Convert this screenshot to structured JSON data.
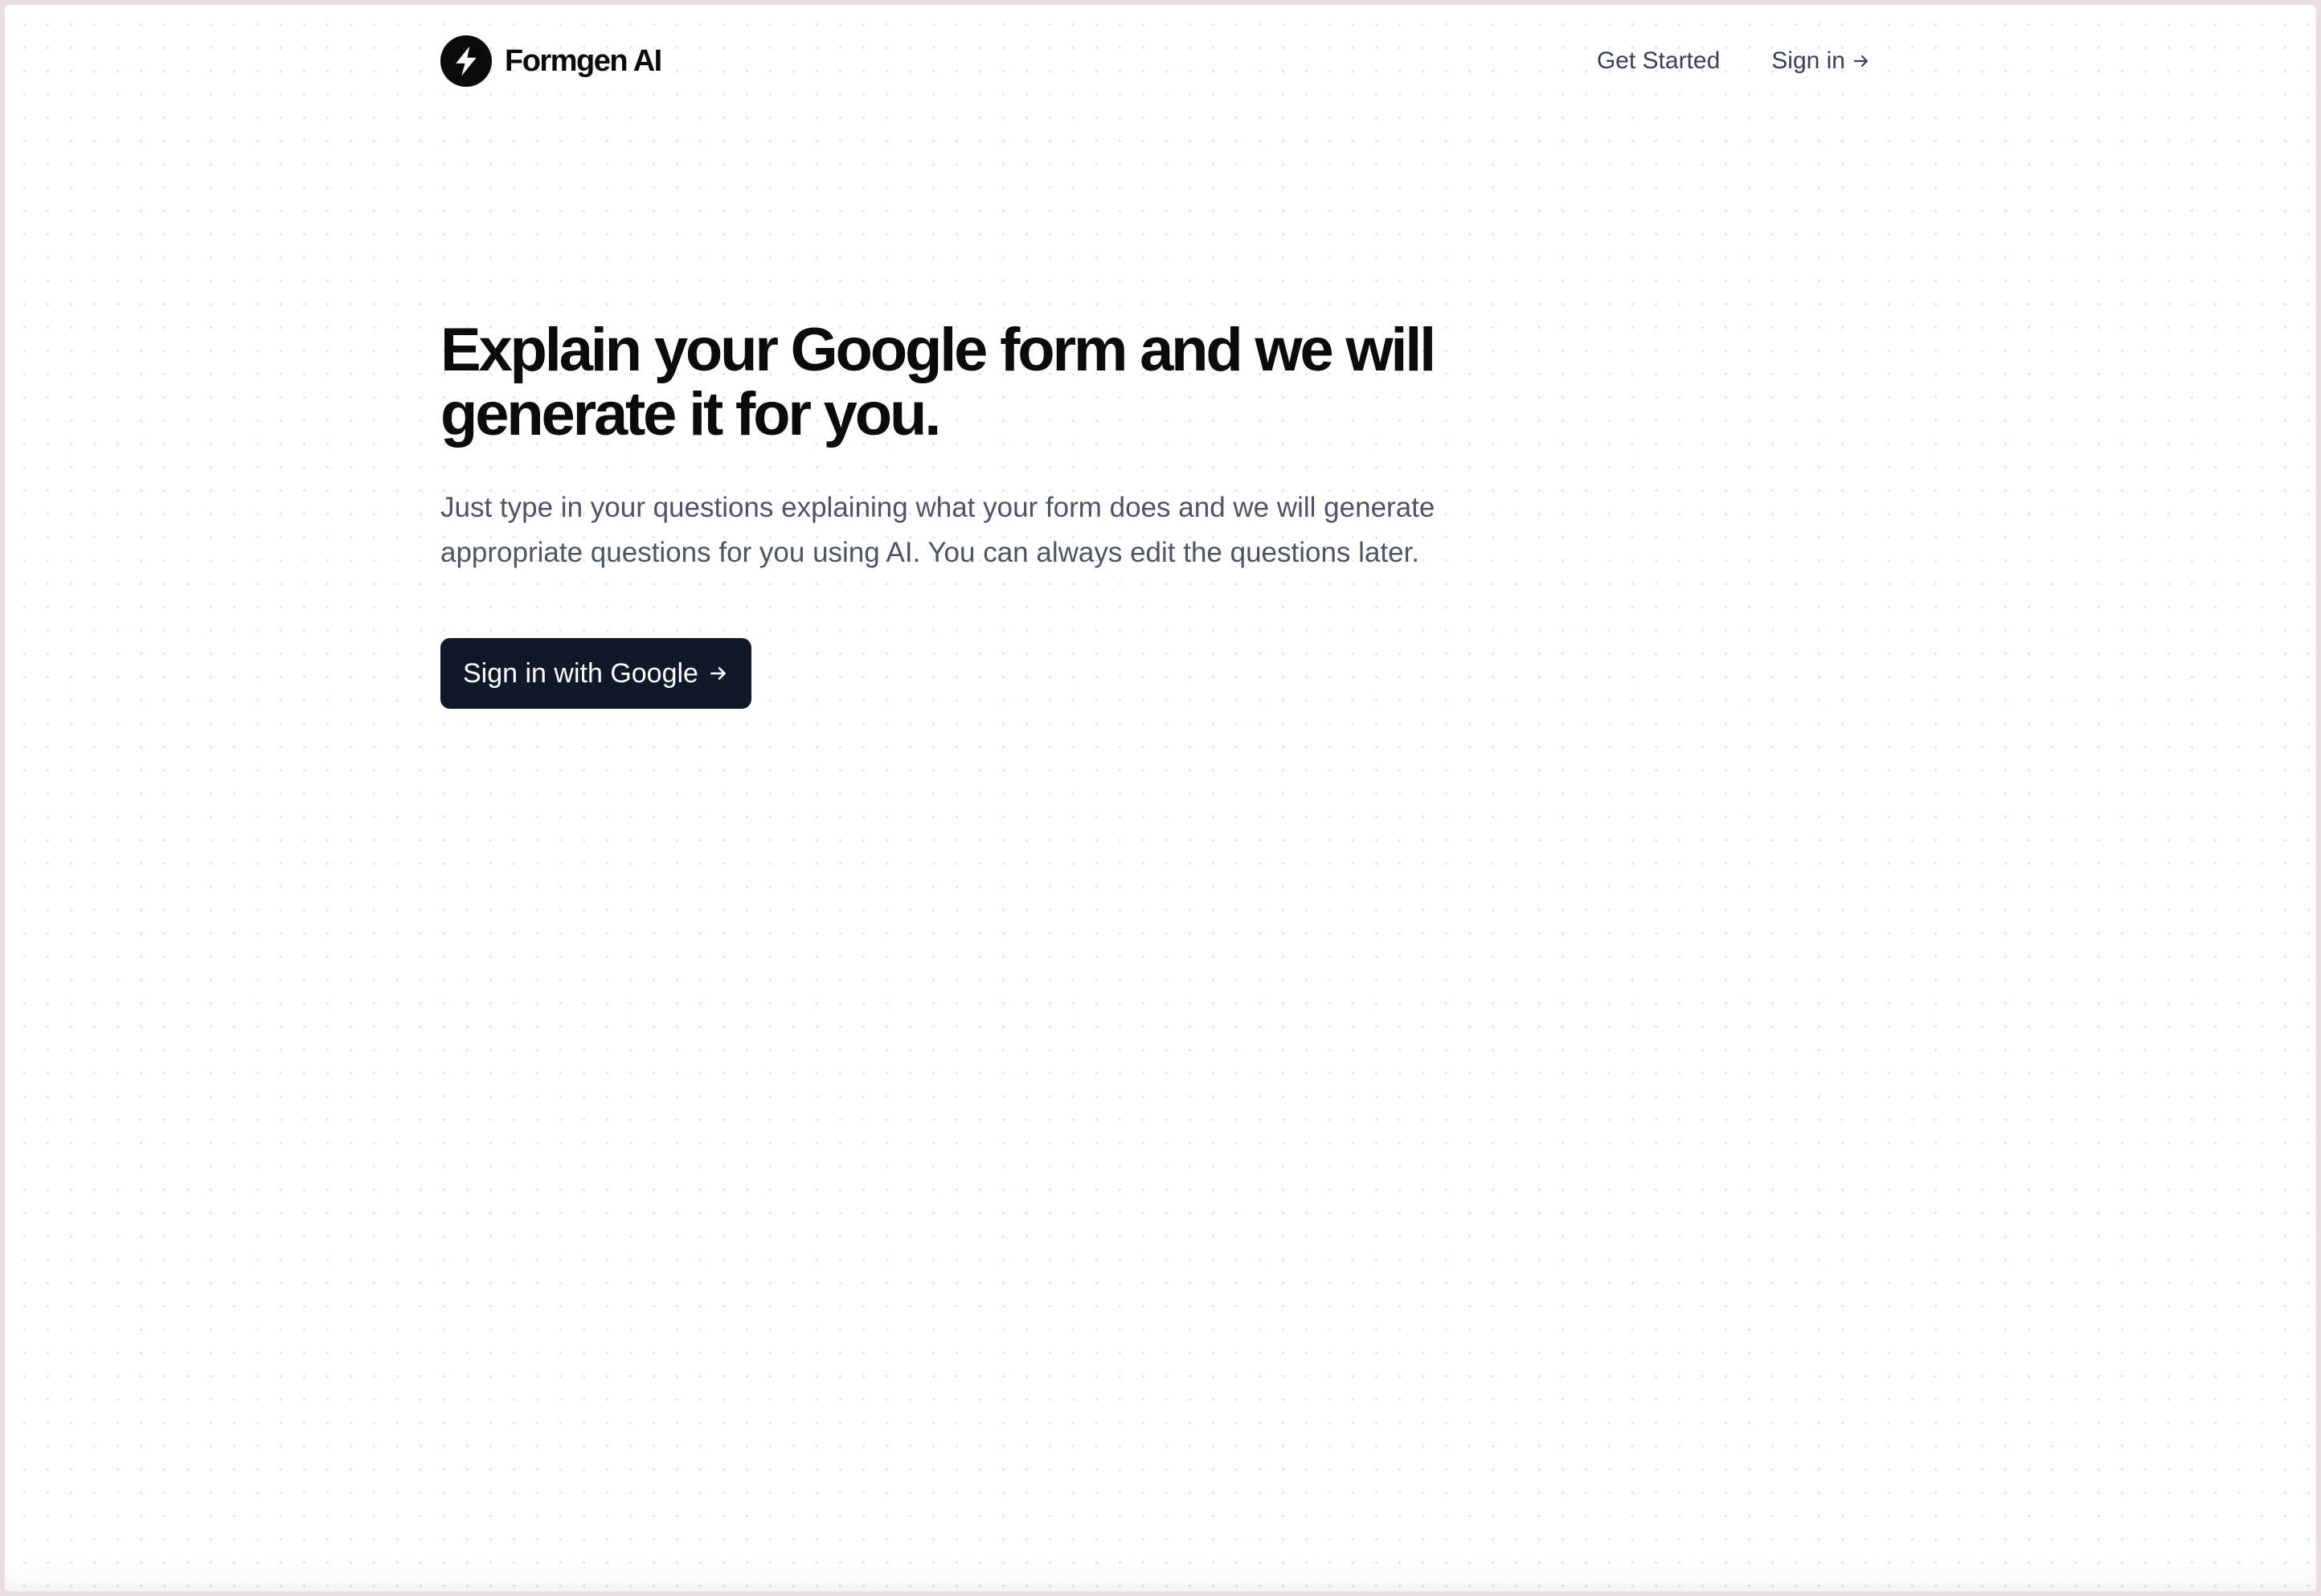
{
  "header": {
    "brand_name": "Formgen AI",
    "logo_icon": "lightning-bolt-icon",
    "nav": {
      "get_started": "Get Started",
      "sign_in": "Sign in"
    }
  },
  "hero": {
    "headline_line1": "Explain your Google form and we will",
    "headline_line2": "generate it for you.",
    "subtext_line1": "Just type in your questions explaining what your form does and we will generate",
    "subtext_line2": "appropriate questions for you using AI. You can always edit the questions later.",
    "cta_label": "Sign in with Google"
  },
  "colors": {
    "primary_dark": "#111827",
    "brand_black": "#0b0b0c",
    "body_text": "#4b5563",
    "nav_text": "#374151"
  }
}
